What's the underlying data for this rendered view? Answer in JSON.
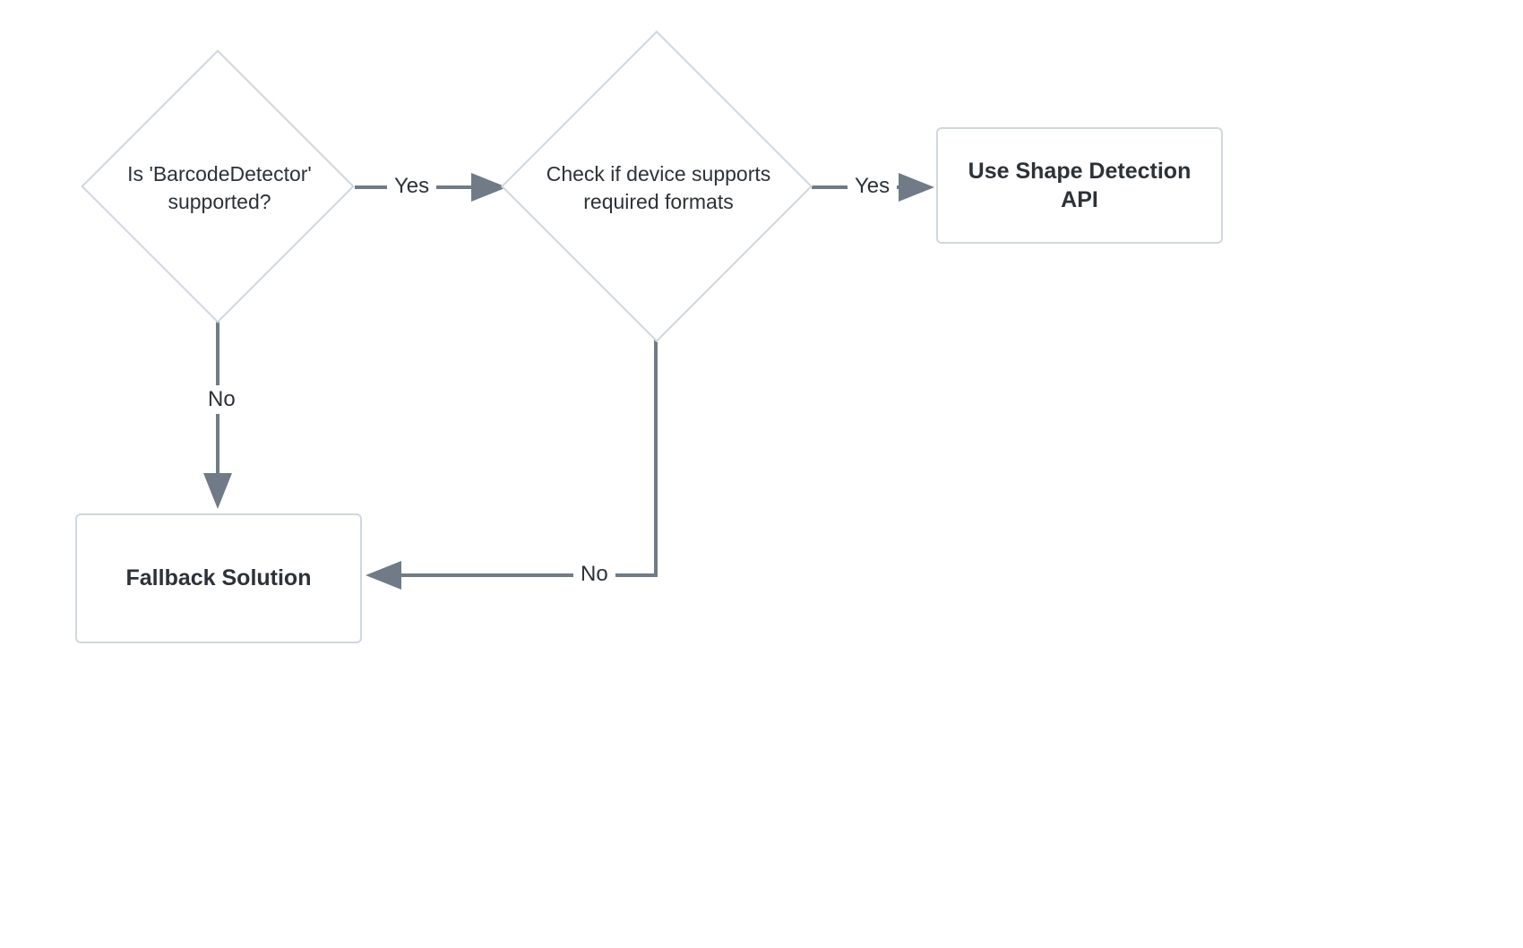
{
  "nodes": {
    "decision_barcode": {
      "line1": "Is 'BarcodeDetector'",
      "line2": "supported?"
    },
    "decision_formats": {
      "line1": "Check if device supports",
      "line2": "required formats"
    },
    "action_shape_api": {
      "line1": "Use Shape Detection",
      "line2": "API"
    },
    "action_fallback": "Fallback Solution"
  },
  "edges": {
    "yes1": "Yes",
    "yes2": "Yes",
    "no1": "No",
    "no2": "No"
  },
  "colors": {
    "stroke": "#707b87",
    "border": "#d1d7e0",
    "text": "#2c3238"
  }
}
